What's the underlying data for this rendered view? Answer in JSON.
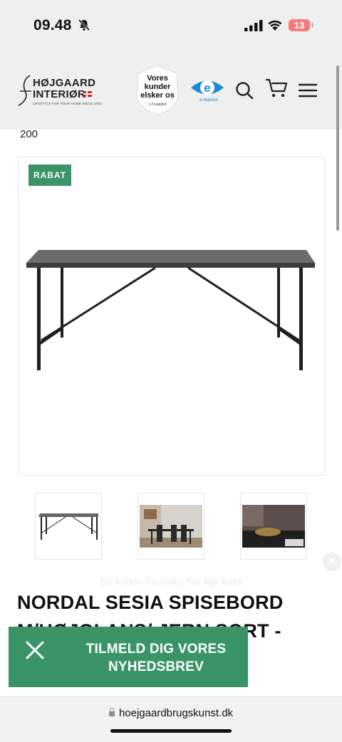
{
  "status_bar": {
    "time": "09.48",
    "battery": "13"
  },
  "header": {
    "logo_line1": "HØJGAARD",
    "logo_line2": "INTERIØR",
    "logo_tagline": "LIFESTYLE FOR YOUR HOME SINCE 2003",
    "trust_badge_text": "Vores kunder elsker os",
    "trust_badge_brand": "Trustpilot",
    "emark_label": "e-mærket",
    "icons": [
      "search-icon",
      "cart-icon",
      "menu-icon"
    ]
  },
  "page": {
    "top_label": "200",
    "badge": "RABAT",
    "thumbnails": [
      "thumbnail-table",
      "thumbnail-dining-room",
      "thumbnail-table-detail"
    ],
    "notification": "En kunde fra Valby har lige købt",
    "product_title_line1": "NORDAL SESIA SPISEBORD",
    "product_title_line2": "M/HØJGLANS/ JERN SORT -"
  },
  "newsletter": {
    "line1": "TILMELD DIG VORES",
    "line2": "NYHEDSBREV"
  },
  "browser": {
    "url": "hoejgaardbrugskunst.dk"
  },
  "colors": {
    "brand_green": "#3a9468",
    "header_bg": "#efefef",
    "battery_low": "#f47c7c"
  }
}
